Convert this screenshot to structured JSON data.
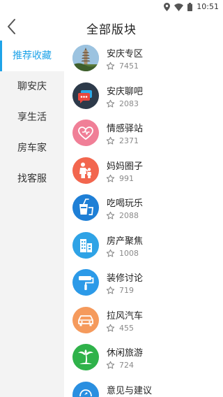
{
  "status_bar": {
    "time": "10:51",
    "icons": [
      "location-icon",
      "wifi-icon",
      "battery-icon"
    ]
  },
  "header": {
    "title": "全部版块",
    "back_icon": "chevron-left-icon"
  },
  "sidebar": {
    "items": [
      {
        "label": "推荐收藏",
        "active": true
      },
      {
        "label": "聊安庆",
        "active": false
      },
      {
        "label": "享生活",
        "active": false
      },
      {
        "label": "房车家",
        "active": false
      },
      {
        "label": "找客服",
        "active": false
      }
    ],
    "accent_color": "#1fa3e8"
  },
  "forums": [
    {
      "name": "安庆专区",
      "count": "7451",
      "icon": "pagoda-photo-icon",
      "color": "#8fb7d8"
    },
    {
      "name": "安庆聊吧",
      "count": "2083",
      "icon": "chat-bubbles-icon",
      "color": "#2d3a4a"
    },
    {
      "name": "情感驿站",
      "count": "2371",
      "icon": "heart-icon",
      "color": "#f07f97"
    },
    {
      "name": "妈妈圈子",
      "count": "991",
      "icon": "mother-child-icon",
      "color": "#f2664e"
    },
    {
      "name": "吃喝玩乐",
      "count": "2088",
      "icon": "drink-cup-icon",
      "color": "#1e7fd6"
    },
    {
      "name": "房产聚焦",
      "count": "1008",
      "icon": "buildings-icon",
      "color": "#2fa3e6"
    },
    {
      "name": "装修讨论",
      "count": "719",
      "icon": "paint-roller-icon",
      "color": "#2c9ae8"
    },
    {
      "name": "拉风汽车",
      "count": "455",
      "icon": "car-icon",
      "color": "#f59a5c"
    },
    {
      "name": "休闲旅游",
      "count": "724",
      "icon": "palm-tree-icon",
      "color": "#2fb24a"
    },
    {
      "name": "意见与建议",
      "count": "",
      "icon": "feedback-icon",
      "color": "#2a8fe0"
    }
  ]
}
